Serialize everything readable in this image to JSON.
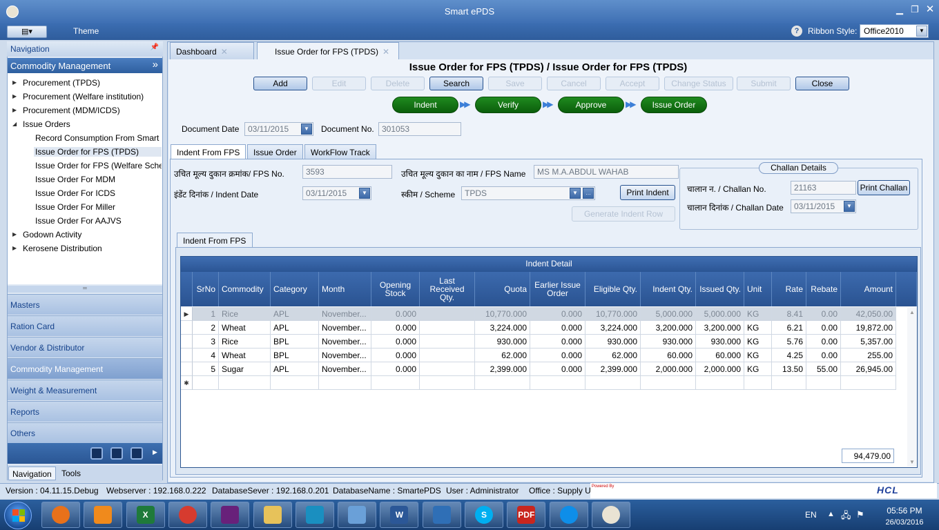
{
  "window": {
    "title": "Smart ePDS"
  },
  "ribbon": {
    "theme_tab": "Theme",
    "style_label": "Ribbon Style:",
    "style_value": "Office2010"
  },
  "navigation": {
    "header": "Navigation",
    "section": "Commodity Management",
    "tree": [
      {
        "label": "Procurement (TPDS)",
        "level": 0,
        "state": "collapsed"
      },
      {
        "label": "Procurement (Welfare institution)",
        "level": 0,
        "state": "collapsed"
      },
      {
        "label": "Procurement (MDM/ICDS)",
        "level": 0,
        "state": "collapsed"
      },
      {
        "label": "Issue Orders",
        "level": 0,
        "state": "expanded"
      },
      {
        "label": "Record Consumption From Smart",
        "level": 1
      },
      {
        "label": "Issue Order for FPS (TPDS)",
        "level": 1,
        "selected": true
      },
      {
        "label": "Issue Order for FPS (Welfare Scher",
        "level": 1
      },
      {
        "label": "Issue Order For MDM",
        "level": 1
      },
      {
        "label": "Issue Order For ICDS",
        "level": 1
      },
      {
        "label": "Issue Order For Miller",
        "level": 1
      },
      {
        "label": "Issue Order For AAJVS",
        "level": 1
      },
      {
        "label": "Godown Activity",
        "level": 0,
        "state": "collapsed"
      },
      {
        "label": "Kerosene Distribution",
        "level": 0,
        "state": "collapsed"
      }
    ],
    "groups": [
      "Masters",
      "Ration Card",
      "Vendor & Distributor",
      "Commodity Management",
      "Weight & Measurement",
      "Reports",
      "Others"
    ],
    "bottom_tabs": [
      "Navigation",
      "Tools"
    ]
  },
  "doc_tabs": [
    {
      "label": "Dashboard"
    },
    {
      "label": "Issue Order for FPS (TPDS)"
    }
  ],
  "page": {
    "title": "Issue Order for FPS (TPDS) / Issue Order for FPS (TPDS)",
    "toolbar": [
      "Add",
      "Edit",
      "Delete",
      "Search",
      "Save",
      "Cancel",
      "Accept",
      "Change Status",
      "Submit",
      "Close"
    ],
    "workflow": [
      "Indent",
      "Verify",
      "Approve",
      "Issue Order"
    ],
    "document_date_label": "Document Date",
    "document_date": "03/11/2015",
    "document_no_label": "Document No.",
    "document_no": "301053",
    "sub_tabs": [
      "Indent From FPS",
      "Issue Order",
      "WorkFlow Track"
    ],
    "fps_no_label": "उचित मूल्य दुकान क्रमांक/ FPS No.",
    "fps_no": "3593",
    "fps_name_label": "उचित मूल्य दुकान का नाम / FPS Name",
    "fps_name": "MS M.A.ABDUL WAHAB",
    "indent_date_label": "इंडेंट दिनांक / Indent Date",
    "indent_date": "03/11/2015",
    "scheme_label": "स्कीम / Scheme",
    "scheme": "TPDS",
    "print_indent": "Print Indent",
    "generate_indent_row": "Generate Indent Row",
    "challan": {
      "header": "Challan Details",
      "no_label": "चालान न. / Challan No.",
      "no": "21163",
      "print": "Print Challan",
      "date_label": "चालान दिनांक / Challan Date",
      "date": "03/11/2015"
    },
    "inner_tab": "Indent From FPS",
    "grid": {
      "caption": "Indent Detail",
      "columns": [
        "SrNo",
        "Commodity",
        "Category",
        "Month",
        "Opening Stock",
        "Last Received Qty.",
        "Quota",
        "Earlier Issue Order",
        "Eligible Qty.",
        "Indent Qty.",
        "Issued Qty.",
        "Unit",
        "Rate",
        "Rebate",
        "Amount"
      ],
      "rows": [
        [
          "1",
          "Rice",
          "APL",
          "November...",
          "0.000",
          "",
          "10,770.000",
          "0.000",
          "10,770.000",
          "5,000.000",
          "5,000.000",
          "KG",
          "8.41",
          "0.00",
          "42,050.00"
        ],
        [
          "2",
          "Wheat",
          "APL",
          "November...",
          "0.000",
          "",
          "3,224.000",
          "0.000",
          "3,224.000",
          "3,200.000",
          "3,200.000",
          "KG",
          "6.21",
          "0.00",
          "19,872.00"
        ],
        [
          "3",
          "Rice",
          "BPL",
          "November...",
          "0.000",
          "",
          "930.000",
          "0.000",
          "930.000",
          "930.000",
          "930.000",
          "KG",
          "5.76",
          "0.00",
          "5,357.00"
        ],
        [
          "4",
          "Wheat",
          "BPL",
          "November...",
          "0.000",
          "",
          "62.000",
          "0.000",
          "62.000",
          "60.000",
          "60.000",
          "KG",
          "4.25",
          "0.00",
          "255.00"
        ],
        [
          "5",
          "Sugar",
          "APL",
          "November...",
          "0.000",
          "",
          "2,399.000",
          "0.000",
          "2,399.000",
          "2,000.000",
          "2,000.000",
          "KG",
          "13.50",
          "55.00",
          "26,945.00"
        ]
      ],
      "total": "94,479.00"
    }
  },
  "status_bar": {
    "version": "Version : 04.11.15.Debug",
    "webserver": "Webserver : 192.168.0.222",
    "dbserver": "DatabaseSever : 192.168.0.201",
    "dbname": "DatabaseName : SmartePDS",
    "user": "User : Administrator",
    "office": "Office : Supply U",
    "powered": "Powered By",
    "brand": "HCL"
  },
  "taskbar": {
    "apps": [
      {
        "icon": "firefox-icon",
        "color": "#e8711a"
      },
      {
        "icon": "media-player-icon",
        "color": "#f08a1c"
      },
      {
        "icon": "excel-icon",
        "color": "#1f7a3a",
        "text": "X"
      },
      {
        "icon": "chrome-icon",
        "color": "#d63b2f"
      },
      {
        "icon": "visual-studio-icon",
        "color": "#68217a"
      },
      {
        "icon": "file-explorer-icon",
        "color": "#e7c25a"
      },
      {
        "icon": "network-icon",
        "color": "#1a8fc0"
      },
      {
        "icon": "tools-icon",
        "color": "#6aa0d8"
      },
      {
        "icon": "word-icon",
        "color": "#2b5797",
        "text": "W"
      },
      {
        "icon": "remote-desktop-icon",
        "color": "#2f6fb6"
      },
      {
        "icon": "skype-icon",
        "color": "#00aff0",
        "text": "S"
      },
      {
        "icon": "pdf-icon",
        "color": "#c8261e",
        "text": "PDF"
      },
      {
        "icon": "teamviewer-icon",
        "color": "#0e8ee9"
      },
      {
        "icon": "smart-epds-icon",
        "color": "#e9e3d3"
      }
    ],
    "lang": "EN",
    "time": "05:56 PM",
    "date": "26/03/2016"
  }
}
